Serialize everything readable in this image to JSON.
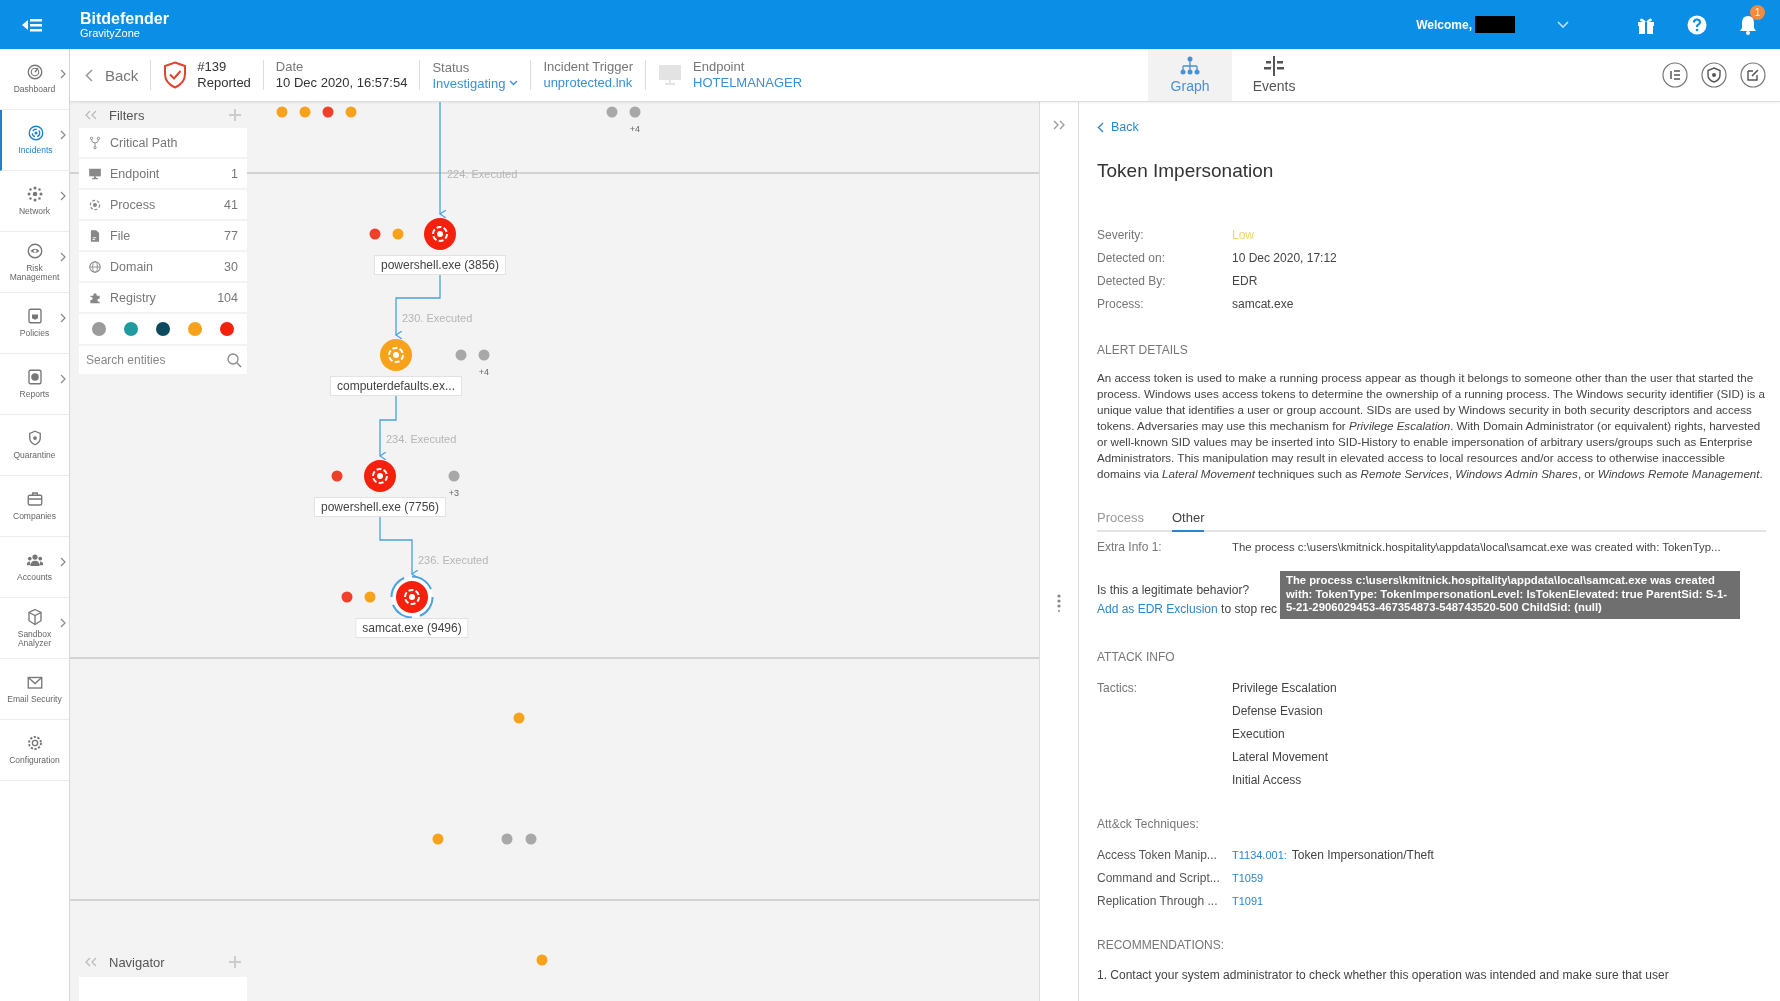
{
  "topbar": {
    "brand": "Bitdefender",
    "product": "GravityZone",
    "welcome": "Welcome,",
    "notification_count": "1"
  },
  "nav": [
    {
      "label": "Dashboard",
      "selected": false,
      "expandable": true
    },
    {
      "label": "Incidents",
      "selected": true,
      "expandable": true
    },
    {
      "label": "Network",
      "selected": false,
      "expandable": true
    },
    {
      "label": "Risk Management",
      "selected": false,
      "expandable": true
    },
    {
      "label": "Policies",
      "selected": false,
      "expandable": true
    },
    {
      "label": "Reports",
      "selected": false,
      "expandable": true
    },
    {
      "label": "Quarantine",
      "selected": false,
      "expandable": false
    },
    {
      "label": "Companies",
      "selected": false,
      "expandable": false
    },
    {
      "label": "Accounts",
      "selected": false,
      "expandable": true
    },
    {
      "label": "Sandbox Analyzer",
      "selected": false,
      "expandable": true
    },
    {
      "label": "Email Security",
      "selected": false,
      "expandable": false
    },
    {
      "label": "Configuration",
      "selected": false,
      "expandable": false
    }
  ],
  "header": {
    "back": "Back",
    "incident_id": "#139",
    "incident_state": "Reported",
    "date_label": "Date",
    "date": "10 Dec 2020, 16:57:54",
    "status_label": "Status",
    "status": "Investigating",
    "trigger_label": "Incident Trigger",
    "trigger": "unprotected.lnk",
    "endpoint_label": "Endpoint",
    "endpoint": "HOTELMANAGER"
  },
  "view_tabs": [
    {
      "label": "Graph",
      "selected": true
    },
    {
      "label": "Events",
      "selected": false
    }
  ],
  "filters": {
    "title": "Filters",
    "items": [
      {
        "label": "Critical Path"
      },
      {
        "label": "Endpoint",
        "count": "1"
      },
      {
        "label": "Process",
        "count": "41"
      },
      {
        "label": "File",
        "count": "77"
      },
      {
        "label": "Domain",
        "count": "30"
      },
      {
        "label": "Registry",
        "count": "104"
      }
    ],
    "colors": [
      {
        "color": "#9b9b9b"
      },
      {
        "color": "#1f9a9e"
      },
      {
        "color": "#0d4a5e"
      },
      {
        "color": "#f7a21b"
      },
      {
        "color": "#f5210d"
      }
    ],
    "search": {
      "placeholder": "Search entities"
    }
  },
  "graph": {
    "nodes": [
      {
        "label": "powershell.exe (3856)",
        "edge_label": "224. Executed",
        "color": "#f5210d",
        "selected": false
      },
      {
        "label": "computerdefaults.ex...",
        "edge_label": "230. Executed",
        "color": "#f7a21b",
        "selected": false
      },
      {
        "label": "powershell.exe (7756)",
        "edge_label": "234. Executed",
        "color": "#f5210d",
        "selected": false
      },
      {
        "label": "samcat.exe (9496)",
        "edge_label": "236. Executed",
        "color": "#f5210d",
        "selected": true
      }
    ],
    "dots": [
      {
        "color": "#f7a21b"
      },
      {
        "color": "#f7a21b"
      },
      {
        "color": "#f0402a"
      },
      {
        "color": "#f7a21b"
      },
      {
        "color": "#a8a8a8"
      },
      {
        "color": "#a8a8a8"
      },
      {
        "color": "#f0402a"
      },
      {
        "color": "#f7a21b"
      },
      {
        "color": "#a8a8a8"
      },
      {
        "color": "#a8a8a8"
      },
      {
        "color": "#f0402a"
      },
      {
        "color": "#a8a8a8"
      },
      {
        "color": "#f0402a"
      },
      {
        "color": "#f7a21b"
      },
      {
        "color": "#f7a21b"
      },
      {
        "color": "#f7a21b"
      },
      {
        "color": "#a8a8a8"
      },
      {
        "color": "#a8a8a8"
      },
      {
        "color": "#f7a21b"
      }
    ],
    "more": [
      "+4",
      "+4",
      "+3"
    ]
  },
  "navigator": {
    "title": "Navigator"
  },
  "detail": {
    "back": "Back",
    "title": "Token Impersonation",
    "fields": [
      {
        "label": "Severity:",
        "value": "Low",
        "kind": "severity"
      },
      {
        "label": "Detected on:",
        "value": "10 Dec 2020, 17:12",
        "kind": "text"
      },
      {
        "label": "Detected By:",
        "value": "EDR",
        "kind": "text"
      },
      {
        "label": "Process:",
        "value": "samcat.exe",
        "kind": "text"
      }
    ],
    "alert_heading": "ALERT DETAILS",
    "description": "An access token is used to make a running process appear as though it belongs to someone other than the user that started the process. Windows uses access tokens to determine the ownership of a running process. The Windows security identifier (SID) is a unique value that identifies a user or group account. SIDs are used by Windows security in both security descriptors and access tokens. Adversaries may use this mechanism for *Privilege Escalation*. With Domain Administrator (or equivalent) rights, harvested or well-known SID values may be inserted into SID-History to enable impersonation of arbitrary users/groups such as Enterprise Administrators. This manipulation may result in elevated access to local resources and/or access to otherwise inaccessible domains via *Lateral Movement* techniques such as *Remote Services*, *Windows Admin Shares*, or *Windows Remote Management*.",
    "tabs": [
      {
        "label": "Process",
        "selected": false
      },
      {
        "label": "Other",
        "selected": true
      }
    ],
    "extra_info": {
      "label": "Extra Info 1:",
      "value": "The process c:\\users\\kmitnick.hospitality\\appdata\\local\\samcat.exe was created with: TokenTyp..."
    },
    "question": "Is this a legitimate behavior?",
    "exclusion_link": "Add as EDR Exclusion",
    "exclusion_rest": "to stop rec",
    "tooltip": "The process c:\\users\\kmitnick.hospitality\\appdata\\local\\samcat.exe was created with: TokenType: TokenImpersonationLevel: IsTokenElevated: true ParentSid: S-1-5-21-2906029453-467354873-548743520-500 ChildSid: (null)",
    "attack_heading": "ATTACK INFO",
    "tactics_label": "Tactics:",
    "tactics": [
      "Privilege Escalation",
      "Defense Evasion",
      "Execution",
      "Lateral Movement",
      "Initial Access"
    ],
    "techniques_heading": "Att&ck Techniques:",
    "techniques": [
      {
        "name": "Access Token Manip...",
        "id": "T1134.001:",
        "description": "Token Impersonation/Theft"
      },
      {
        "name": "Command and Script...",
        "id": "T1059"
      },
      {
        "name": "Replication Through ...",
        "id": "T1091"
      }
    ],
    "recommendations_heading": "RECOMMENDATIONS:",
    "recommendations": [
      "1. Contact your system administrator to check whether this operation was intended and make sure that user"
    ]
  }
}
